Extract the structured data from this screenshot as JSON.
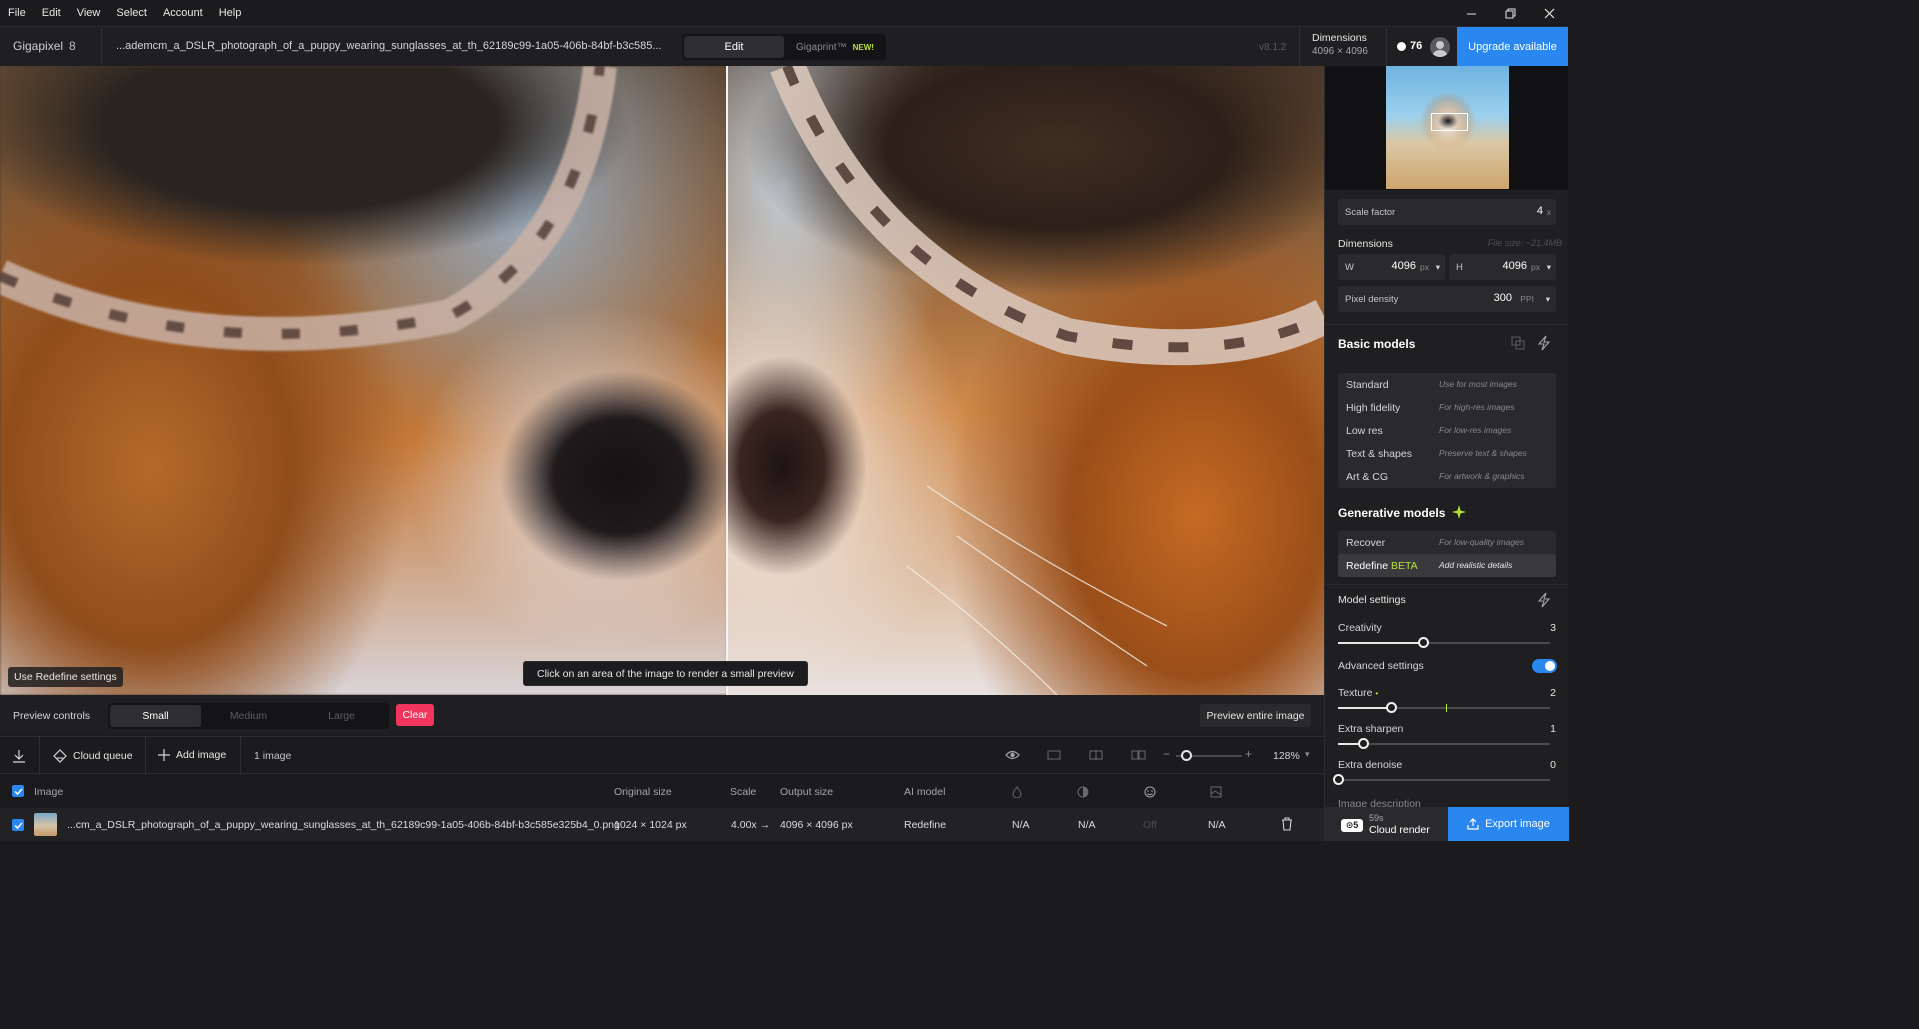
{
  "menu": [
    "File",
    "Edit",
    "View",
    "Select",
    "Account",
    "Help"
  ],
  "header": {
    "app_name": "Gigapixel",
    "app_major": "8",
    "filename": "...ademcm_a_DSLR_photograph_of_a_puppy_wearing_sunglasses_at_th_62189c99-1a05-406b-84bf-b3c585...",
    "tab_edit": "Edit",
    "tab_gigaprint": "Gigaprint™",
    "new_badge": "NEW!",
    "version": "v8.1.2",
    "dimensions_title": "Dimensions",
    "dimensions_value": "4096 × 4096",
    "credits": "76",
    "upgrade_label": "Upgrade available"
  },
  "viewport": {
    "redefine_tag": "Use Redefine settings",
    "hint": "Click on an area of the image to render a small preview"
  },
  "preview_controls": {
    "label": "Preview controls",
    "sizes": [
      "Small",
      "Medium",
      "Large"
    ],
    "selected": "Small",
    "clear": "Clear",
    "preview_entire": "Preview entire image"
  },
  "toolbar": {
    "cloud_queue": "Cloud queue",
    "add_image": "Add image",
    "image_count": "1 image",
    "zoom_level": "128%",
    "zoom_fraction": 0.15
  },
  "table": {
    "headers": {
      "image": "Image",
      "original_size": "Original size",
      "scale": "Scale",
      "output_size": "Output size",
      "ai_model": "AI model"
    },
    "row": {
      "filename": "...cm_a_DSLR_photograph_of_a_puppy_wearing_sunglasses_at_th_62189c99-1a05-406b-84bf-b3c585e325b4_0.png",
      "original_size": "1024 × 1024 px",
      "scale": "4.00x",
      "arrow": "→",
      "output_size": "4096 × 4096 px",
      "ai_model": "Redefine",
      "col1": "N/A",
      "col2": "N/A",
      "col3": "Off",
      "col4": "N/A"
    }
  },
  "panel": {
    "scale_factor_label": "Scale factor",
    "scale_factor_value": "4",
    "scale_factor_unit": "x",
    "dimensions_label": "Dimensions",
    "file_size": "File size: ~21.4MB",
    "width_label": "W",
    "width_value": "4096",
    "height_label": "H",
    "height_value": "4096",
    "px_unit": "px",
    "pixel_density_label": "Pixel density",
    "pixel_density_value": "300",
    "ppi_unit": "PPI",
    "basic_models_title": "Basic models",
    "basic_models": [
      {
        "name": "Standard",
        "desc": "Use for most images"
      },
      {
        "name": "High fidelity",
        "desc": "For high-res images"
      },
      {
        "name": "Low res",
        "desc": "For low-res images"
      },
      {
        "name": "Text & shapes",
        "desc": "Preserve text & shapes"
      },
      {
        "name": "Art & CG",
        "desc": "For artwork & graphics"
      }
    ],
    "generative_models_title": "Generative models",
    "generative_models": [
      {
        "name": "Recover",
        "desc": "For low-quality images"
      },
      {
        "name": "Redefine",
        "beta": "BETA",
        "desc": "Add realistic details"
      }
    ],
    "model_settings_title": "Model settings",
    "creativity_label": "Creativity",
    "creativity_value": "3",
    "creativity_fraction": 0.4,
    "advanced_label": "Advanced settings",
    "advanced_on": true,
    "texture_label": "Texture",
    "texture_value": "2",
    "texture_fraction": 0.25,
    "extra_sharpen_label": "Extra sharpen",
    "extra_sharpen_value": "1",
    "extra_sharpen_fraction": 0.12,
    "extra_denoise_label": "Extra denoise",
    "extra_denoise_value": "0",
    "extra_denoise_fraction": 0.0,
    "image_description_label": "Image description"
  },
  "bottom": {
    "cloud_time": "59s",
    "cloud_render": "Cloud render",
    "export": "Export image"
  },
  "colors": {
    "accent": "#2a87f0",
    "clear": "#f1355c",
    "beta": "#b7e23b"
  }
}
